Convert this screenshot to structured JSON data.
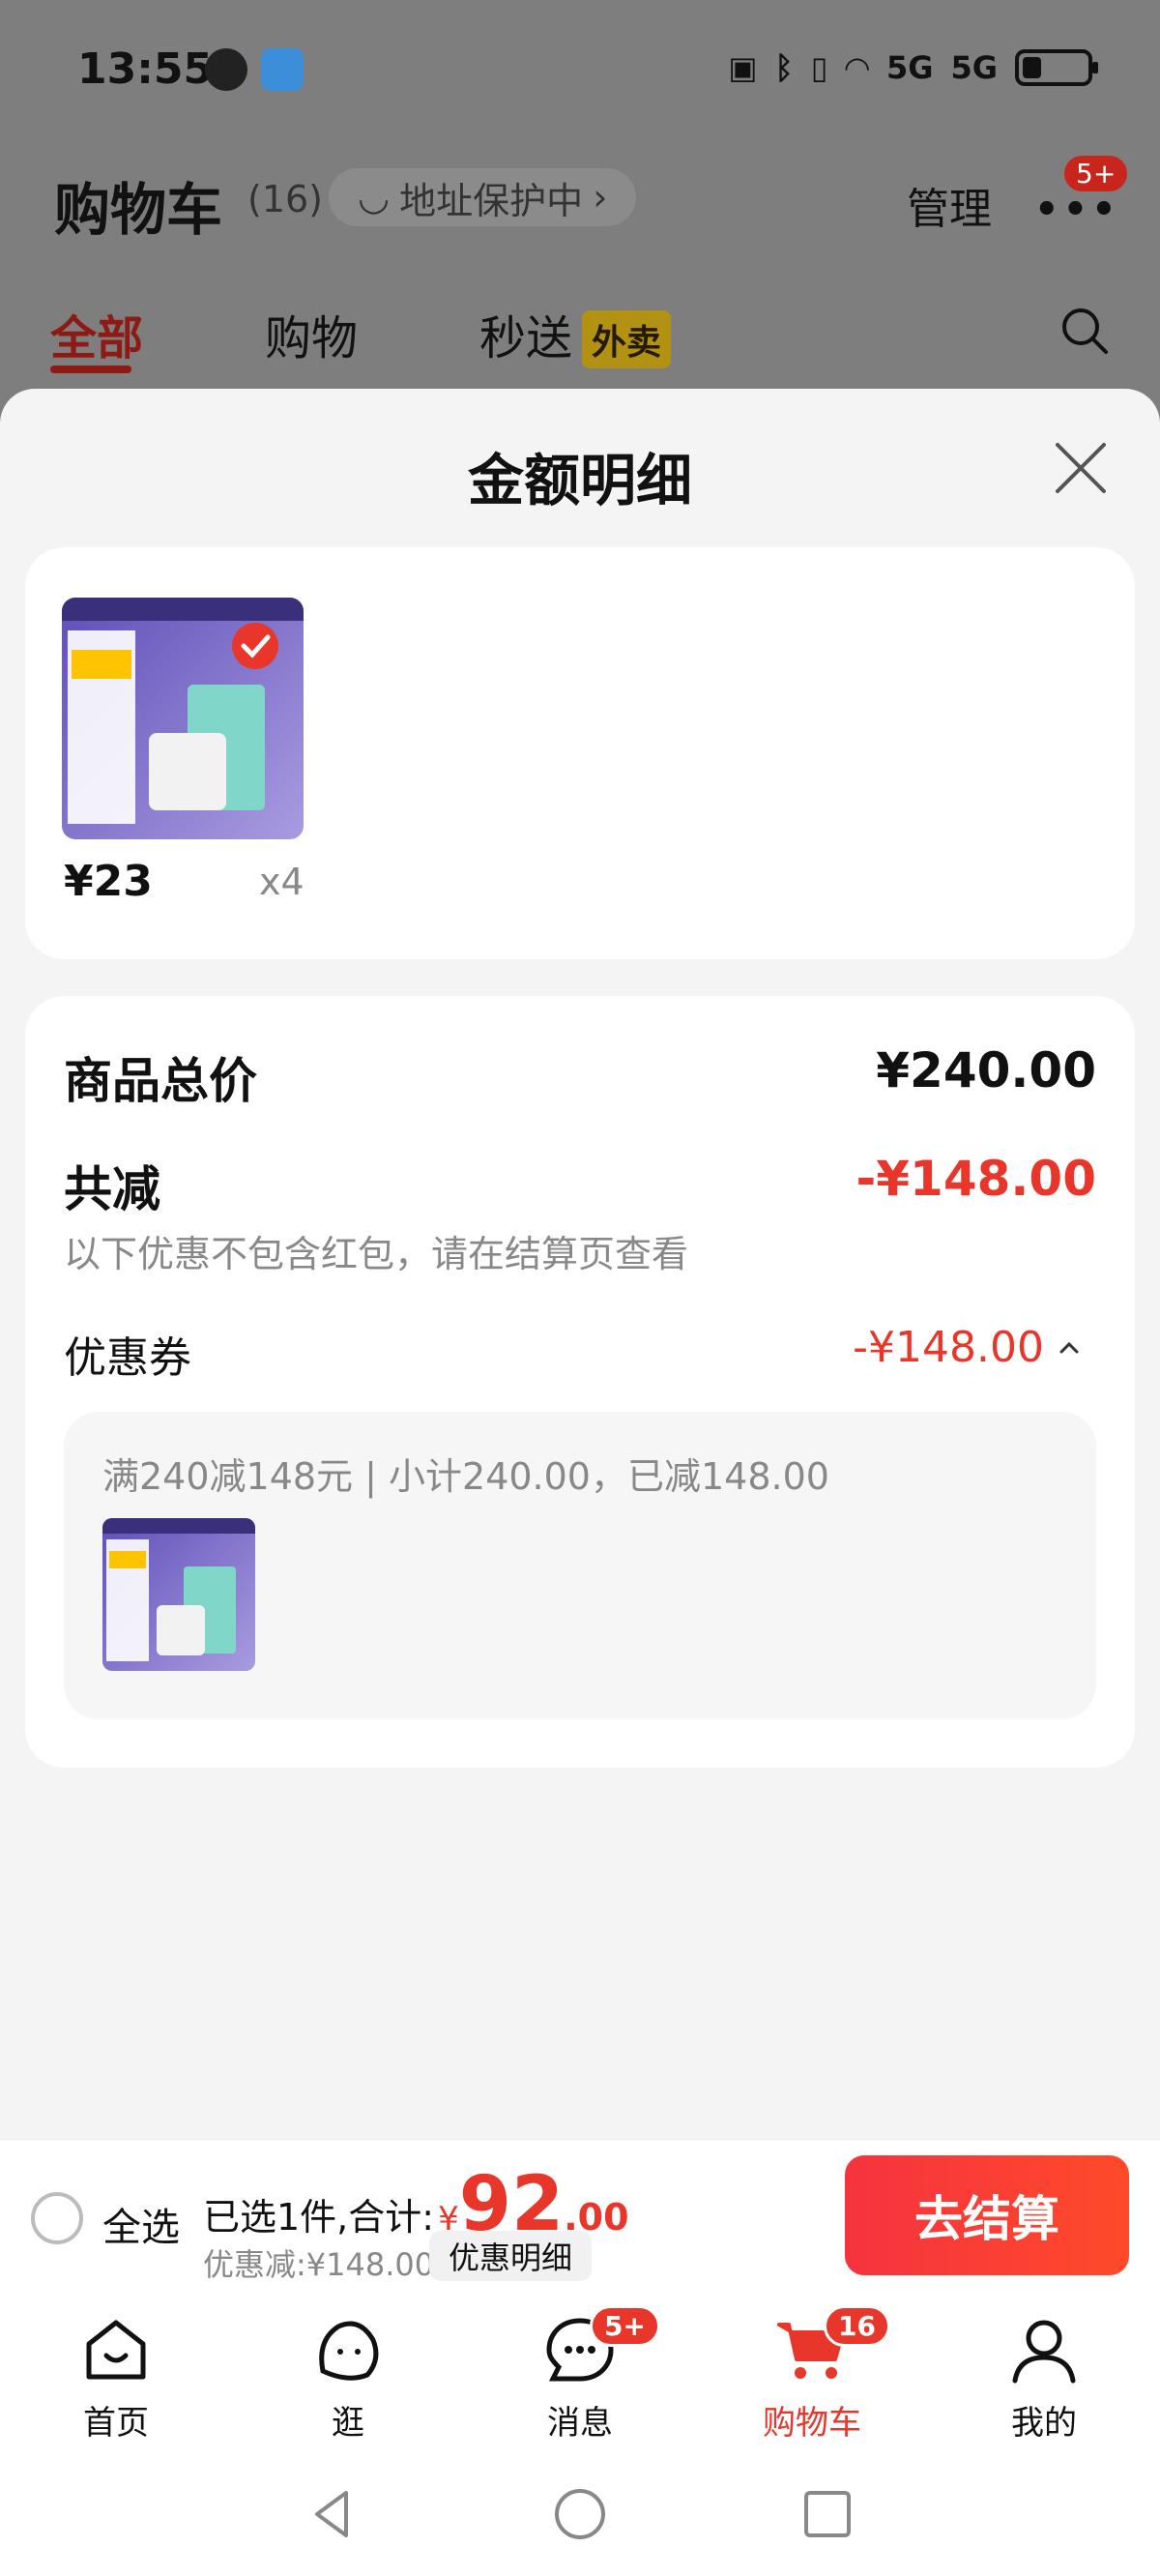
{
  "status": {
    "time": "13:55",
    "signal1": "5G",
    "signal2": "5G",
    "battery_level": 0.3
  },
  "header": {
    "title": "购物车",
    "count": "(16)",
    "address": "地址保护中",
    "manage": "管理",
    "more_badge": "5+"
  },
  "tabs": {
    "all": "全部",
    "shopping": "购物",
    "quick": "秒送",
    "quick_badge": "外卖"
  },
  "sheet": {
    "title": "金额明细",
    "product": {
      "price": "¥23",
      "qty": "x4"
    },
    "total_label": "商品总价",
    "total_value": "¥240.00",
    "reduce_label": "共减",
    "reduce_value": "-¥148.00",
    "note": "以下优惠不包含红包，请在结算页查看",
    "coupon_label": "优惠券",
    "coupon_value": "-¥148.00",
    "coupon_detail": "满240减148元 | 小计240.00，已减148.00"
  },
  "checkout": {
    "select_all": "全选",
    "summary_prefix": "已选1件,合计:",
    "currency": "¥",
    "total_int": "92",
    "total_dec": ".00",
    "discount": "优惠减:¥148.00",
    "discount_btn": "优惠明细",
    "pay": "去结算"
  },
  "tabbar": {
    "home": "首页",
    "browse": "逛",
    "messages": "消息",
    "messages_badge": "5+",
    "cart": "购物车",
    "cart_badge": "16",
    "mine": "我的"
  }
}
